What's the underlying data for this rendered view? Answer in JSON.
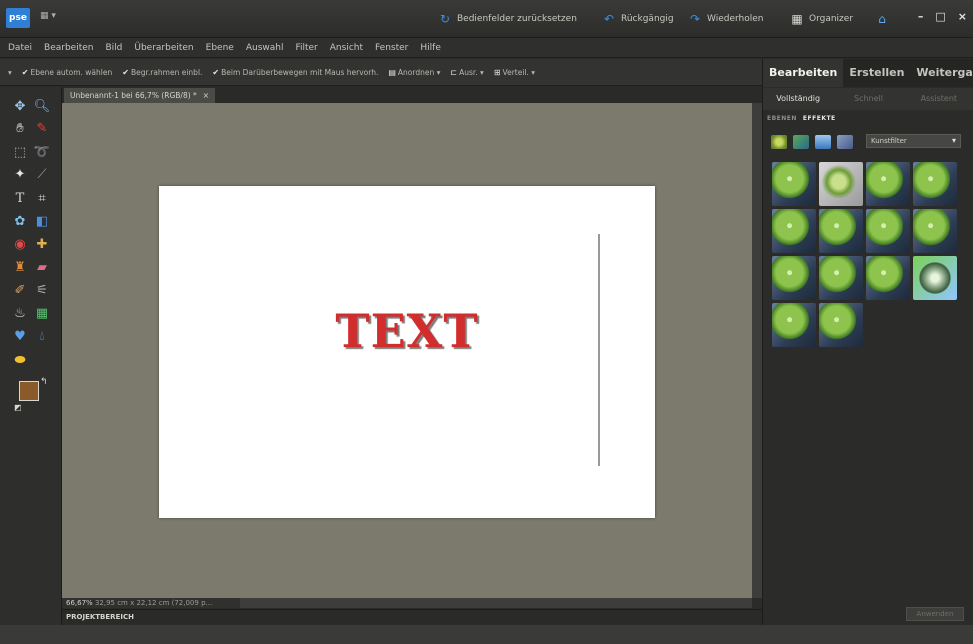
{
  "titlebar": {
    "logo": "pse",
    "layout_label": "▦ ▾",
    "reset": "Bedienfelder zurücksetzen",
    "undo": "Rückgängig",
    "redo": "Wiederholen",
    "organizer": "Organizer",
    "minimize": "–",
    "maximize": "□",
    "close": "×"
  },
  "menu": [
    "Datei",
    "Bearbeiten",
    "Bild",
    "Überarbeiten",
    "Ebene",
    "Auswahl",
    "Filter",
    "Ansicht",
    "Fenster",
    "Hilfe"
  ],
  "options": {
    "auto_select": "Ebene autom. wählen",
    "bounding_box": "Begr.rahmen einbl.",
    "hover_highlight": "Beim Darüberbewegen mit Maus hervorh.",
    "arrange": "Anordnen ▾",
    "align": "Ausr. ▾",
    "distribute": "Verteil. ▾"
  },
  "document": {
    "tab_title": "Unbenannt-1 bei 66,7% (RGB/8) *",
    "tab_close": "×",
    "text": "TEXT"
  },
  "status": {
    "zoom": "66,67%",
    "info": "32,95 cm x 22,12 cm (72,009 p..."
  },
  "project_area": "PROJEKTBEREICH",
  "right_panel": {
    "tabs": [
      "Bearbeiten",
      "Erstellen",
      "Weitergabe"
    ],
    "sub_tabs": [
      "Vollständig",
      "Schnell",
      "Assistent"
    ],
    "panel_tabs": [
      "EBENEN",
      "EFFEKTE"
    ],
    "filter_value": "Kunstfilter",
    "apply_label": "Anwenden"
  },
  "colors": {
    "accent": "#2f7fd6",
    "text_red": "#d12d2d",
    "foreground": "#8b5a2b",
    "background": "#ffffff"
  }
}
